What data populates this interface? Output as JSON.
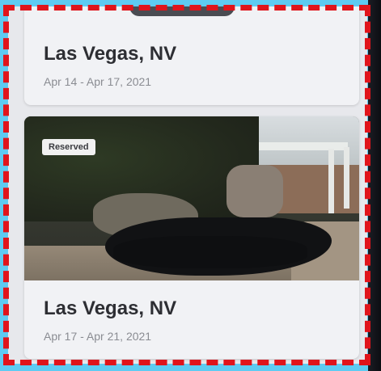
{
  "listings": [
    {
      "title": "Las Vegas, NV",
      "dates": "Apr 14 - Apr 17, 2021"
    },
    {
      "badge": "Reserved",
      "title": "Las Vegas, NV",
      "dates": "Apr 17 - Apr 21, 2021"
    }
  ],
  "colors": {
    "card_background": "#f1f2f5",
    "title_text": "#2d2e33",
    "date_text": "#8a8c92",
    "badge_background": "#f1f1f1"
  }
}
